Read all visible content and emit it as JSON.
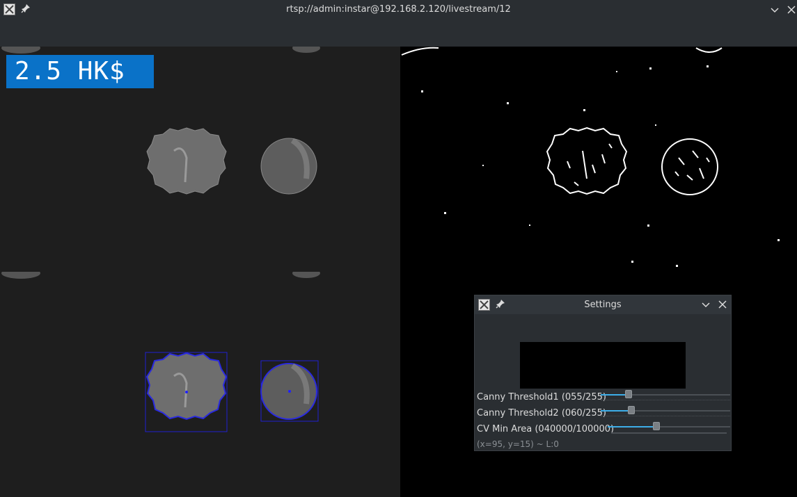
{
  "window": {
    "title": "rtsp://admin:instar@192.168.2.120/livestream/12",
    "icon": "x-app-icon",
    "pin_icon": "pin-icon",
    "controls": [
      "chevron-down-icon",
      "close-icon"
    ]
  },
  "overlay": {
    "label": "2.5 HK$",
    "label_bg": "#0a72c8"
  },
  "settings": {
    "title": "Settings",
    "sliders": [
      {
        "label": "Canny Threshold1 (055/255)",
        "value": 55,
        "max": 255
      },
      {
        "label": "Canny Threshold2 (060/255)",
        "value": 60,
        "max": 255
      },
      {
        "label": "CV Min Area (040000/100000)",
        "value": 40000,
        "max": 100000
      }
    ],
    "status": "(x=95, y=15) ~ L:0"
  },
  "colors": {
    "accent": "#3daee9",
    "detection_box": "#2020d0"
  }
}
